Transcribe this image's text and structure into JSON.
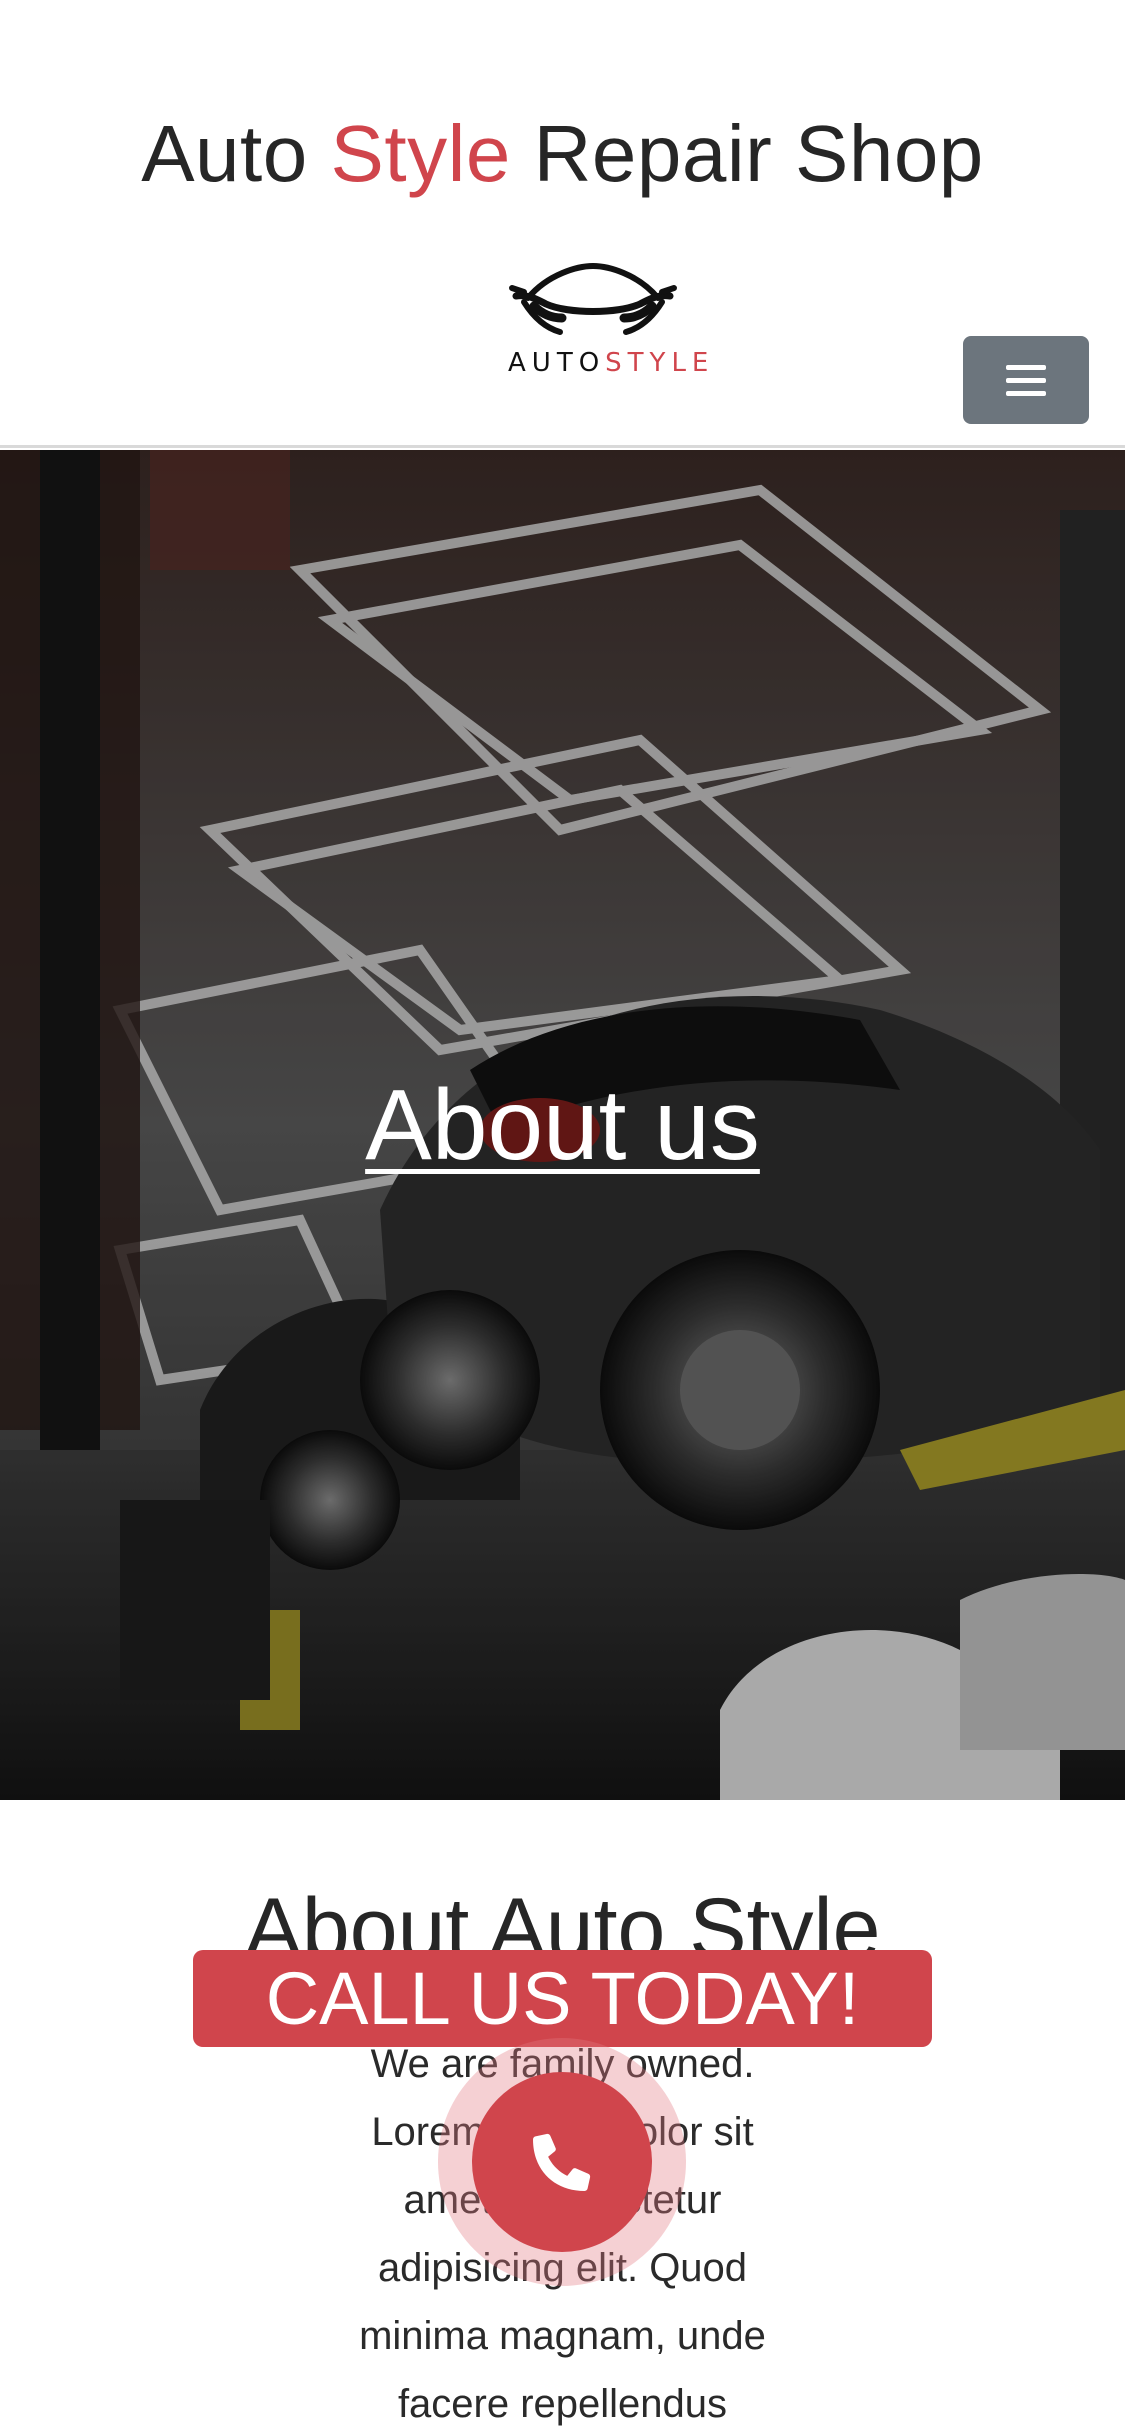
{
  "header": {
    "title_part1": "Auto ",
    "title_accent": "Style",
    "title_part2": " Repair Shop",
    "logo_text_part1": "AUTO",
    "logo_text_part2": "STYLE",
    "menu_icon": "hamburger-icon"
  },
  "hero": {
    "title": "About us",
    "image_subject": "car-on-lift-garage"
  },
  "about": {
    "heading": "About Auto Style",
    "body": "We are family owned. Lorem ipsum dolor sit amet, consectetur adipisicing elit. Quod minima magnam, unde facere repellendus"
  },
  "call": {
    "label": "CALL US TODAY!",
    "icon": "phone-icon"
  },
  "colors": {
    "accent": "#d0454c",
    "menu_button": "#6c757d",
    "text": "#262626"
  }
}
